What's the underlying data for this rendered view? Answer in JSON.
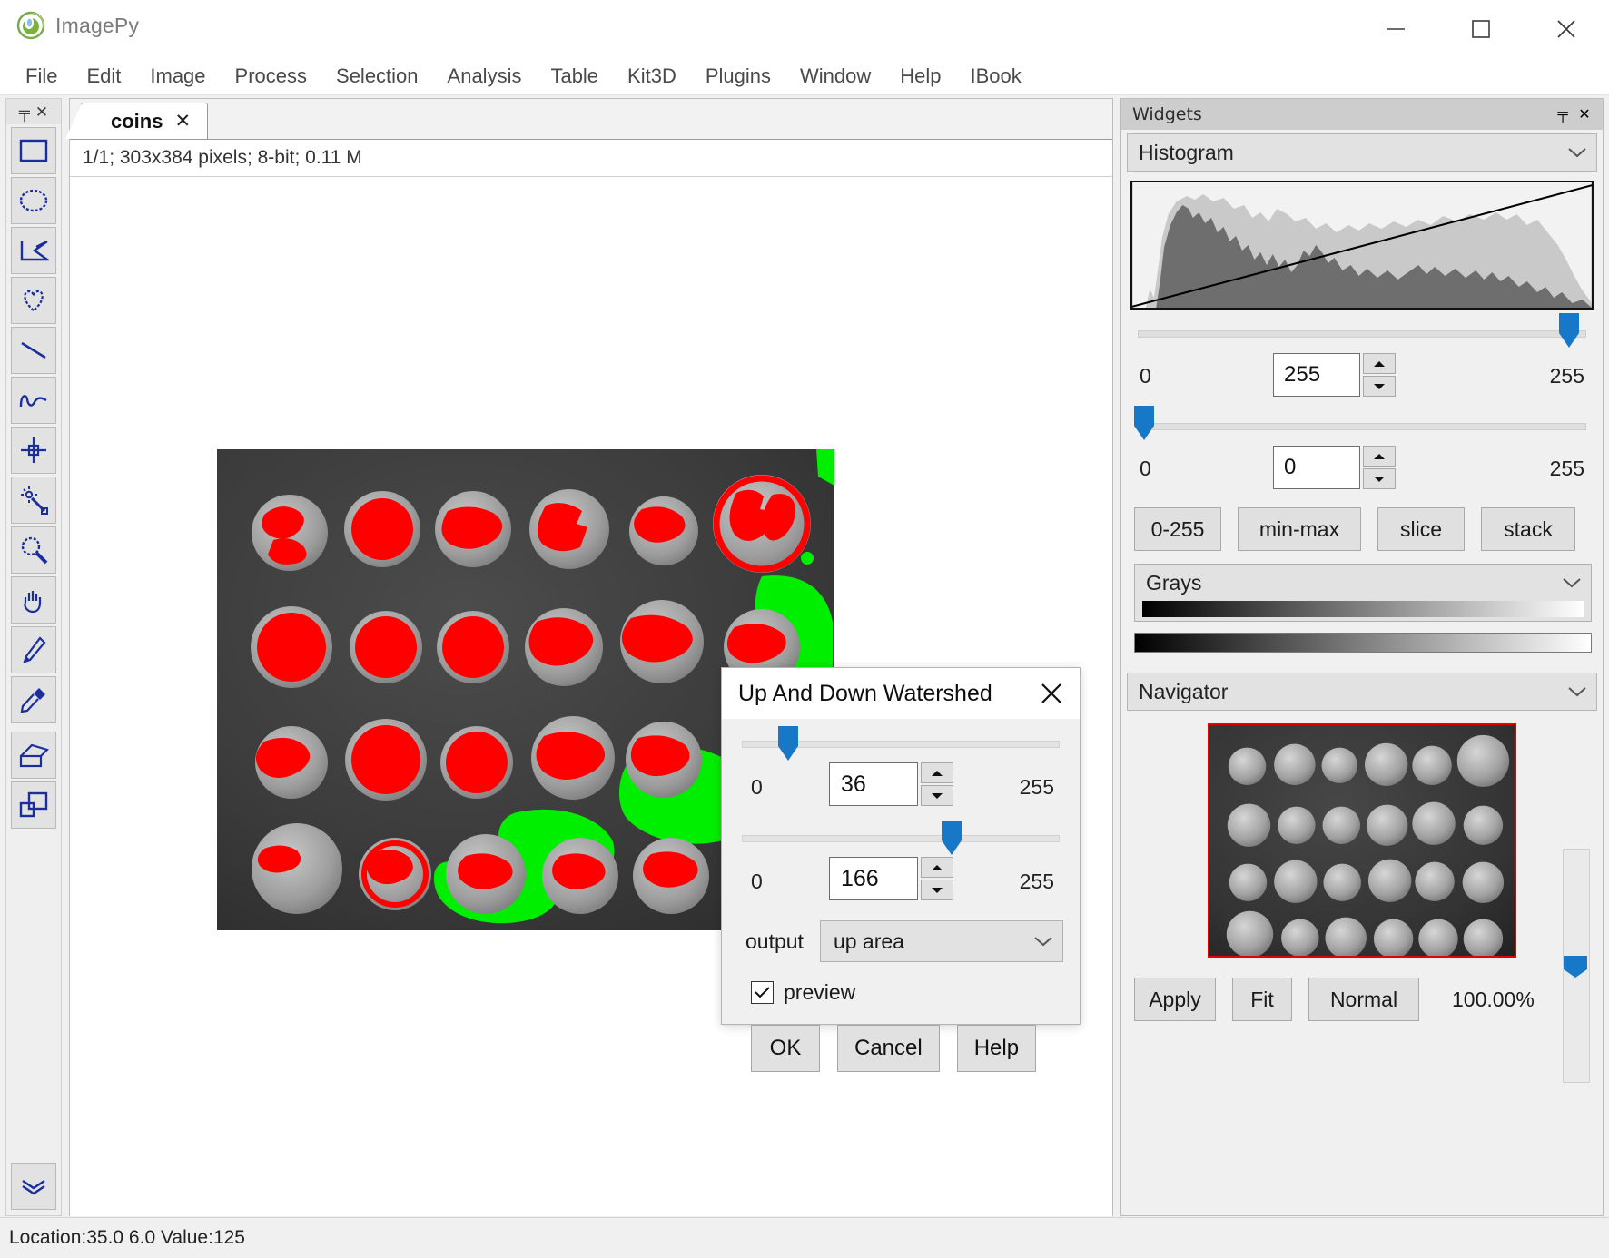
{
  "app": {
    "title": "ImagePy",
    "logo_icon": "imagepy-logo-icon",
    "window_controls": {
      "minimize": "minimize-icon",
      "maximize": "maximize-icon",
      "close": "close-icon"
    }
  },
  "menubar": {
    "items": [
      {
        "label": "File"
      },
      {
        "label": "Edit"
      },
      {
        "label": "Image"
      },
      {
        "label": "Process"
      },
      {
        "label": "Selection"
      },
      {
        "label": "Analysis"
      },
      {
        "label": "Table"
      },
      {
        "label": "Kit3D"
      },
      {
        "label": "Plugins"
      },
      {
        "label": "Window"
      },
      {
        "label": "Help"
      },
      {
        "label": "IBook"
      }
    ]
  },
  "toolbar": {
    "pin_glyph": "╤",
    "close_glyph": "✕",
    "tools": [
      {
        "name": "rectangle-select-tool"
      },
      {
        "name": "ellipse-select-tool"
      },
      {
        "name": "polygon-select-tool"
      },
      {
        "name": "freehand-select-tool"
      },
      {
        "name": "line-tool"
      },
      {
        "name": "curve-tool"
      },
      {
        "name": "point-tool"
      },
      {
        "name": "magic-wand-tool"
      },
      {
        "name": "zoom-tool"
      },
      {
        "name": "pan-hand-tool"
      },
      {
        "name": "pencil-tool"
      },
      {
        "name": "eyedropper-tool"
      },
      {
        "name": "eraser-tool"
      },
      {
        "name": "copy-layer-tool"
      }
    ],
    "more_tool": {
      "name": "more-tools-chevron"
    }
  },
  "document": {
    "tab_label": "coins",
    "tab_close_glyph": "✕",
    "info": "1/1;   303x384 pixels; 8-bit; 0.11 M",
    "image_name": "coins-preview-image"
  },
  "statusbar": {
    "text": "Location:35.0 6.0   Value:125"
  },
  "widgets": {
    "panel_title": "Widgets",
    "pin_glyph": "╤",
    "close_glyph": "✕",
    "histogram": {
      "title": "Histogram",
      "max_slider": {
        "min_label": "0",
        "max_label": "255",
        "value": "255",
        "percent": 100
      },
      "min_slider": {
        "min_label": "0",
        "max_label": "255",
        "value": "0",
        "percent": 0
      },
      "range_buttons": [
        {
          "label": "0-255"
        },
        {
          "label": "min-max"
        },
        {
          "label": "slice"
        },
        {
          "label": "stack"
        }
      ],
      "colormap": {
        "name": "Grays"
      }
    },
    "navigator": {
      "title": "Navigator",
      "buttons": [
        {
          "label": "Apply"
        },
        {
          "label": "Fit"
        },
        {
          "label": "Normal"
        }
      ],
      "zoom_label": "100.00%",
      "scroll_percent": 48
    }
  },
  "dialog": {
    "title": "Up And Down Watershed",
    "close_glyph": "✕",
    "slider_up": {
      "min_label": "0",
      "max_label": "255",
      "value": "36",
      "percent": 14
    },
    "slider_down": {
      "min_label": "0",
      "max_label": "255",
      "value": "166",
      "percent": 65
    },
    "output": {
      "label": "output",
      "value": "up area"
    },
    "preview": {
      "label": "preview",
      "checked": true,
      "check_glyph": "✓"
    },
    "buttons": [
      {
        "label": "OK"
      },
      {
        "label": "Cancel"
      },
      {
        "label": "Help"
      }
    ]
  },
  "colors": {
    "accent_blue": "#1878c8",
    "overlay_red": "#ff0000",
    "overlay_green": "#00ee00",
    "navigator_border": "#e60000"
  }
}
